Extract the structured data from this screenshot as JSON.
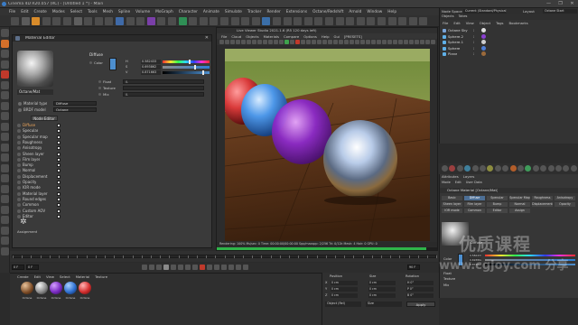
{
  "window": {
    "title": "Cinema 4D R20.057 (RC) - [Untitled 1 *] - Main",
    "controls": [
      "—",
      "❐",
      "✕"
    ]
  },
  "menubar": [
    "File",
    "Edit",
    "Create",
    "Modes",
    "Select",
    "Tools",
    "Mesh",
    "Spline",
    "Volume",
    "MoGraph",
    "Character",
    "Animate",
    "Simulate",
    "Tracker",
    "Render",
    "Extensions",
    "Octane/Redshift",
    "Arnold",
    "Window",
    "Help"
  ],
  "material_editor": {
    "title": "Material Editor",
    "material_name": "Octane/Mat",
    "settings": [
      {
        "label": "Material type",
        "value": "Diffuse"
      },
      {
        "label": "BRDF model",
        "value": "Octane"
      }
    ],
    "node_editor_button": "Node Editor",
    "channels": [
      {
        "label": "Diffuse",
        "checked": true,
        "active": true
      },
      {
        "label": "Specular",
        "checked": true
      },
      {
        "label": "Specular map",
        "checked": true
      },
      {
        "label": "Roughness",
        "checked": true
      },
      {
        "label": "Anisotropy",
        "checked": true
      },
      {
        "label": "Sheen layer",
        "checked": true
      },
      {
        "label": "Film layer",
        "checked": true
      },
      {
        "label": "Bump",
        "checked": true
      },
      {
        "label": "Normal",
        "checked": true
      },
      {
        "label": "Displacement",
        "checked": true
      },
      {
        "label": "Opacity",
        "checked": true
      },
      {
        "label": "IOR mode",
        "checked": true
      },
      {
        "label": "Material layer",
        "checked": true
      },
      {
        "label": "Round edges",
        "checked": true
      },
      {
        "label": "Common",
        "checked": true
      },
      {
        "label": "Custom AOV",
        "checked": true
      },
      {
        "label": "Editor",
        "checked": true
      }
    ],
    "diffuse_header": "Diffuse",
    "color_label": "Color",
    "color_hex": "#4d8fcf",
    "sliders": [
      {
        "label": "H",
        "value": "0.582433",
        "fraction": 0.58,
        "gradient": "linear-gradient(90deg,#ff2f2f,#ffe02f,#2fff4e,#2fd5ff,#2f3dff,#ff2fd8,#ff2f2f)"
      },
      {
        "label": "S",
        "value": "0.693862",
        "fraction": 0.69,
        "gradient": "linear-gradient(90deg,#8a8a8a,#2e7fd6)"
      },
      {
        "label": "V",
        "value": "0.871663",
        "fraction": 0.87,
        "gradient": "linear-gradient(90deg,#000,#4d8fcf)"
      }
    ],
    "fields": [
      {
        "label": "Float",
        "value": "0."
      },
      {
        "label": "Texture",
        "value": ""
      },
      {
        "label": "Mix",
        "value": "0."
      }
    ],
    "assign_label": "Assignment"
  },
  "render_viewer": {
    "title": "Live Viewer Studio 2021.1.6 (R5 120 days left)",
    "menu": [
      "File",
      "Cloud",
      "Objects",
      "Materials",
      "Compare",
      "Options",
      "Help",
      "Gui",
      "[PRESETS]"
    ],
    "status": "Rendering: 100%  Ms/sec: 0  Time: 00:00:00/00:00:00  Spp/maxspp: 2/256  Tri: 0/12k  Mesh: 4  Hair: 0  GPU: 0",
    "progress": 0.95
  },
  "object_manager": {
    "node_space_label": "Node Space",
    "node_space_value": "Current (Standard/Physical)",
    "layout_label": "Layout",
    "layout_value": "Octane Start",
    "tabs": [
      "Objects",
      "Takes"
    ],
    "menu": [
      "File",
      "Edit",
      "View",
      "Object",
      "Tags",
      "Bookmarks"
    ],
    "objects": [
      {
        "name": "Octane Sky",
        "color": "#7aa3d6",
        "tag": "#e0e0e0"
      },
      {
        "name": "Sphere.2",
        "color": "#5fb0e8",
        "tag": "#8a3fd1"
      },
      {
        "name": "Sphere.1",
        "color": "#5fb0e8",
        "tag": "#cfcfcf"
      },
      {
        "name": "Sphere",
        "color": "#5fb0e8",
        "tag": "#4e7fd8"
      },
      {
        "name": "Plane",
        "color": "#5fb0e8",
        "tag": "#9b6a3b"
      }
    ]
  },
  "attribute_manager": {
    "menu": [
      "Attributes",
      "Layers"
    ],
    "submenu": [
      "Mode",
      "Edit",
      "User Data"
    ],
    "title": "Octane Material [Octane/Mat]",
    "tabs": [
      "Basic",
      "Diffuse",
      "Specular",
      "Specular Map",
      "Roughness",
      "Anisotropy",
      "Sheen layer",
      "Film layer",
      "Bump",
      "Normal",
      "Displacement",
      "Opacity",
      "IOR mode",
      "Common",
      "Editor",
      "Assign"
    ],
    "active_tab": "Diffuse",
    "section": "Diffuse",
    "color_label": "Color",
    "sliders": [
      {
        "value": "0.582433",
        "gradient": "linear-gradient(90deg,#ff2f2f,#ffe02f,#2fff4e,#2fd5ff,#2f3dff,#ff2fd8,#ff2f2f)"
      },
      {
        "value": "0.693862",
        "gradient": "linear-gradient(90deg,#8a8a8a,#2e7fd6)"
      },
      {
        "value": "0.871663",
        "gradient": "linear-gradient(90deg,#000,#4d8fcf)"
      }
    ],
    "float_label": "Float",
    "texture_label": "Texture",
    "mix_label": "Mix"
  },
  "timeline": {
    "start": "0 F",
    "end": "90 F",
    "current": "0 F"
  },
  "material_manager": {
    "menu": [
      "Create",
      "Edit",
      "View",
      "Select",
      "Material",
      "Texture"
    ],
    "materials": [
      {
        "name": "Octane",
        "color": "radial-gradient(circle at 35% 30%, #e8c39a, #7a4a25 60%, #2a170a)"
      },
      {
        "name": "Octane",
        "color": "radial-gradient(circle at 35% 30%, #f5f5f5, #8c8c8c 55%, #222)"
      },
      {
        "name": "Octane",
        "color": "radial-gradient(circle at 35% 30%, #d4a0ff, #7a2bc2 55%, #2b0e45)"
      },
      {
        "name": "Octane",
        "color": "radial-gradient(circle at 35% 30%, #a9d1ff, #2e6fd0 55%, #0c1f45)"
      },
      {
        "name": "Octane",
        "color": "radial-gradient(circle at 35% 30%, #ffb4b4, #d32d2d 55%, #4a0d0d)"
      }
    ]
  },
  "coordinates": {
    "position_label": "Position",
    "size_label": "Size",
    "rotation_label": "Rotation",
    "rows": [
      {
        "axis": "X",
        "pos": "0 cm",
        "size": "0 cm",
        "rot": "H 0°"
      },
      {
        "axis": "Y",
        "pos": "0 cm",
        "size": "0 cm",
        "rot": "P 0°"
      },
      {
        "axis": "Z",
        "pos": "0 cm",
        "size": "0 cm",
        "rot": "B 0°"
      }
    ],
    "mode1": "Object (Rel)",
    "mode2": "Size",
    "apply": "Apply"
  },
  "watermark": {
    "line1": "优质课程",
    "line2": "www.cgjoy.com 分享"
  }
}
